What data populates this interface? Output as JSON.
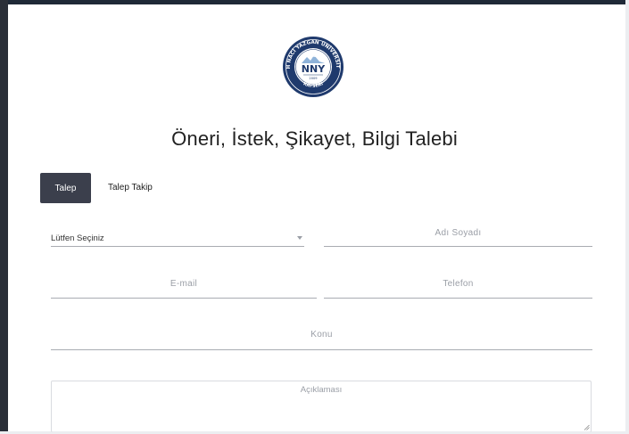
{
  "logo": {
    "abbreviation": "NNY",
    "ring_text": "NUH NACİ YAZGAN ÜNİVERSİTESİ",
    "year": "2009",
    "city": "KAYSERİ"
  },
  "page": {
    "title": "Öneri, İstek, Şikayet, Bilgi Talebi"
  },
  "tabs": [
    {
      "label": "Talep",
      "active": true
    },
    {
      "label": "Talep Takip",
      "active": false
    }
  ],
  "form": {
    "type_select": {
      "value": "Lütfen Seçiniz"
    },
    "name": {
      "placeholder": "Adı Soyadı"
    },
    "email": {
      "placeholder": "E-mail"
    },
    "phone": {
      "placeholder": "Telefon"
    },
    "subject": {
      "placeholder": "Konu"
    },
    "description": {
      "placeholder": "Açıklaması"
    }
  },
  "colors": {
    "active_tab_bg": "#3b3f4c",
    "frame_dark": "#2a2f38",
    "logo_navy": "#1f3a6d"
  }
}
